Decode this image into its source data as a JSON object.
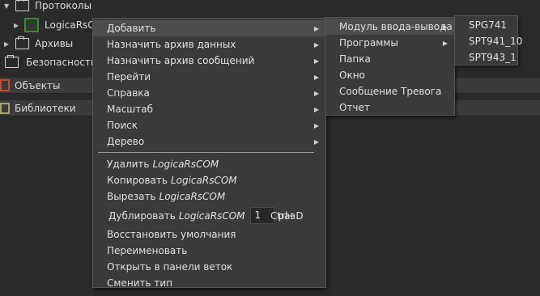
{
  "tree": {
    "protocols": "Протоколы",
    "logica_node": "LogicaRsCOM",
    "archives": "Архивы",
    "security": "Безопасность",
    "objects": "Объекты",
    "libraries": "Библиотеки"
  },
  "context_menu": {
    "add": "Добавить",
    "assign_data_archive": "Назначить архив данных",
    "assign_message_archive": "Назначить архив сообщений",
    "goto": "Перейти",
    "help": "Справка",
    "scale": "Масштаб",
    "search": "Поиск",
    "tree": "Дерево",
    "delete_prefix": "Удалить",
    "copy_prefix": "Копировать",
    "cut_prefix": "Вырезать",
    "duplicate_prefix": "Дублировать",
    "target": "LogicaRsCOM",
    "duplicate_count": "1",
    "duplicate_unit": "раз",
    "duplicate_shortcut": "Ctrl+D",
    "restore_defaults": "Восстановить умолчания",
    "rename": "Переименовать",
    "open_in_branch_panel": "Открыть в панели веток",
    "change_type": "Сменить тип"
  },
  "add_submenu": {
    "io_module": "Модуль ввода-вывода",
    "programs": "Программы",
    "folder": "Папка",
    "window": "Окно",
    "alarm_message": "Сообщение Тревога",
    "report": "Отчет"
  },
  "io_submenu": [
    "SPG741",
    "SPT941_10",
    "SPT943_1"
  ],
  "icons": {
    "expand": "triangle-down",
    "collapsed": "triangle-right",
    "submenu": "triangle-right",
    "folder": "folder-icon",
    "module": "chip-icon",
    "objects": "objects-icon",
    "libraries": "library-icon"
  },
  "colors": {
    "background": "#2a2a2a",
    "menu_bg": "#3a3a3a",
    "highlight": "#4d4d4d",
    "module_green": "#3a8a3a",
    "objects_red": "#c44a35"
  }
}
